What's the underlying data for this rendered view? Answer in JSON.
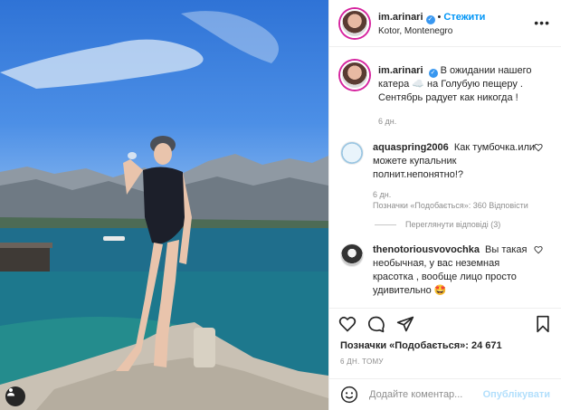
{
  "post": {
    "username": "im.arinari",
    "follow_label": "Стежити",
    "separator": "•",
    "location": "Kotor, Montenegro",
    "more_label": "•••"
  },
  "caption": {
    "username": "im.arinari",
    "text": "В ожидании нашего катера ☁️ на Голубую пещеру . Сентябрь радует как никогда !",
    "time": "6 дн."
  },
  "comments": [
    {
      "username": "aquaspring2006",
      "text": "Как тумбочка.или можете купальник полнит.непонятно!?",
      "time": "6 дн.",
      "likes": "Позначки «Подобається»: 360",
      "reply_label": "Відповісти",
      "view_replies": "Переглянути відповіді (3)"
    },
    {
      "username": "thenotoriousvovochka",
      "text": "Вы такая необычная, у вас неземная красотка , вообще лицо просто удивительно 🤩",
      "time": ""
    }
  ],
  "likes_summary": "Позначки «Подобається»: 24 671",
  "post_time": "6 ДН. ТОМУ",
  "add_comment": {
    "placeholder": "Додайте коментар...",
    "publish_label": "Опублікувати",
    "emoji_icon": "smiley-icon"
  },
  "icons": [
    "heart-icon",
    "comment-icon",
    "share-icon",
    "bookmark-icon",
    "verified-icon",
    "user-tag-icon"
  ],
  "colors": {
    "accent": "#0095f6",
    "publish_disabled": "#b2dffc",
    "verified": "#3897f0",
    "muted": "#8e8e8e"
  }
}
